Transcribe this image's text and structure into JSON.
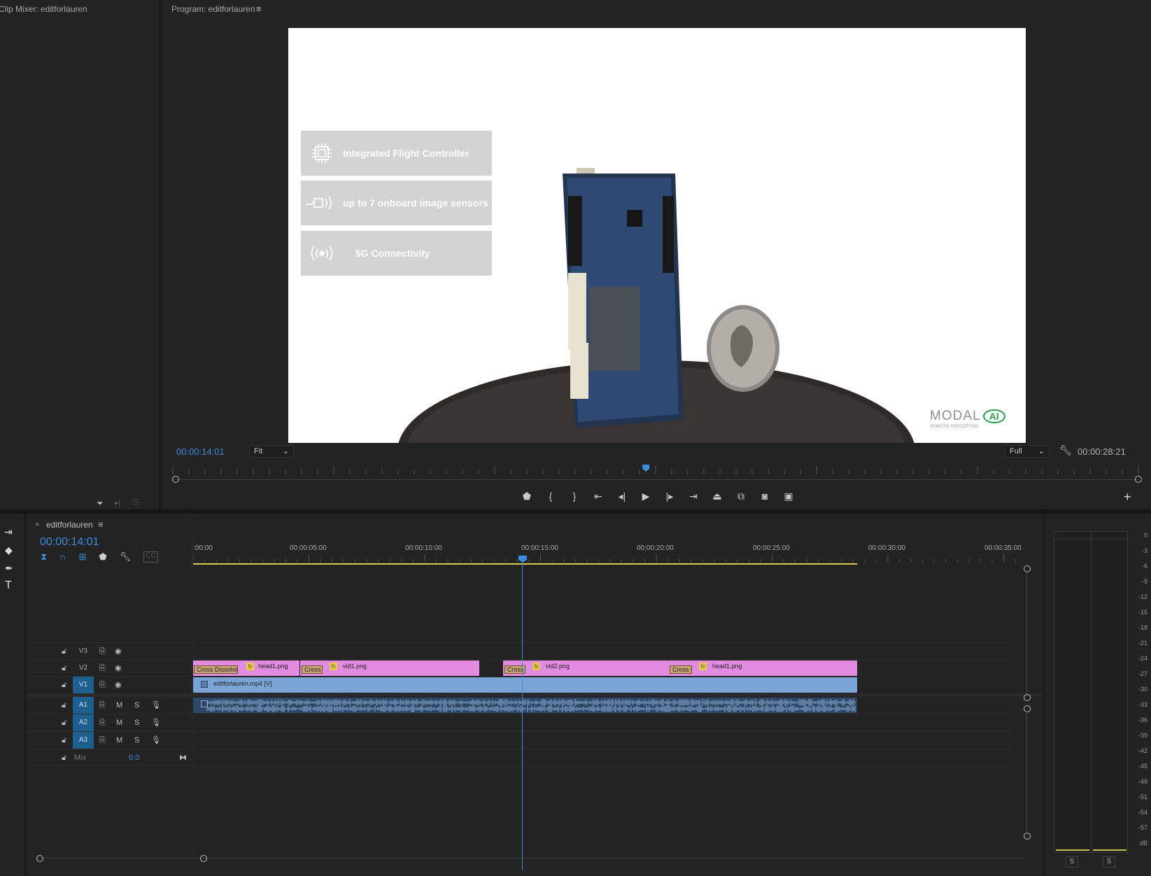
{
  "clip_mixer": {
    "title": "Clip Mixer: editforlauren"
  },
  "program": {
    "title": "Program: editforlauren",
    "menu_icon": "hamburger-icon",
    "timecode_current": "00:00:14:01",
    "timecode_duration": "00:00:28:21",
    "zoom_select": "Fit",
    "resolution_select": "Full",
    "playhead_fraction": 0.49,
    "frame": {
      "features": [
        {
          "icon": "chip-icon",
          "label": "Integrated Flight Controller"
        },
        {
          "icon": "camera-sensor-icon",
          "label": "up to 7 onboard image sensors"
        },
        {
          "icon": "wireless-icon",
          "label": "5G Connectivity"
        }
      ],
      "logo_text": "MODAL",
      "logo_ai": "AI",
      "logo_sub": "ROBOTIC PERCEPTION"
    },
    "transport": [
      "marker-icon",
      "mark-in-icon",
      "mark-out-icon",
      "go-to-in-icon",
      "step-back-icon",
      "play-icon",
      "step-forward-icon",
      "go-to-out-icon",
      "lift-icon",
      "extract-icon",
      "export-frame-icon",
      "compare-icon"
    ]
  },
  "timeline": {
    "tab_close": "×",
    "tab_title": "editforlauren",
    "timecode": "00:00:14:01",
    "ruler_labels": [
      ":00:00",
      "00:00:05:00",
      "00:00:10:00",
      "00:00:15:00",
      "00:00:20:00",
      "00:00:25:00",
      "00:00:30:00",
      "00:00:35:00"
    ],
    "tracks": {
      "v3": "V3",
      "v2": "V2",
      "v1": "V1",
      "a1": "A1",
      "a2": "A2",
      "a3": "A3",
      "mix_label": "Mix",
      "mix_value": "0.0",
      "m": "M",
      "s": "S"
    },
    "clips": {
      "cross_dissolve_1": "Cross Dissolve",
      "head1_a": "head1.png",
      "cross_2": "Cross D",
      "vid1": "vid1.png",
      "cross_3": "Cross D",
      "vid2": "vid2.png",
      "cross_4": "Cross D",
      "head1_b": "head1.png",
      "v1_clip": "editforlauren.mp4 [V]"
    }
  },
  "meter": {
    "db_labels": [
      "0",
      "-3",
      "-6",
      "-9",
      "-12",
      "-15",
      "-18",
      "-21",
      "-24",
      "-27",
      "-30",
      "-33",
      "-36",
      "-39",
      "-42",
      "-45",
      "-48",
      "-51",
      "-54",
      "-57",
      "dB"
    ],
    "solo_left": "S",
    "solo_right": "S"
  }
}
